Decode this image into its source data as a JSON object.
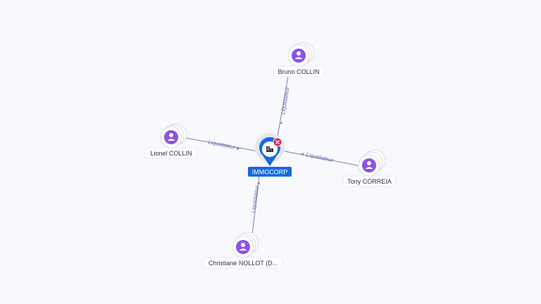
{
  "colors": {
    "background": "#f8f9fc",
    "person_node": "#8b52e8",
    "company_pin": "#1769e0",
    "status_badge": "#e5254a",
    "edge": "#7d80a6"
  },
  "center": {
    "label": "IMMOCORP",
    "icon": "building-icon",
    "badge_icon": "close-icon"
  },
  "nodes": [
    {
      "id": "bruno",
      "label": "Bruno COLLIN",
      "icon": "person-icon",
      "relation": "Liquidateur"
    },
    {
      "id": "lionel",
      "label": "Lionel COLLIN",
      "icon": "person-icon",
      "relation": "Liquidateur"
    },
    {
      "id": "tony",
      "label": "Tony CORREIA",
      "icon": "person-icon",
      "relation": "Liquidateur"
    },
    {
      "id": "christiane",
      "label": "Christiane NOLLOT (D...",
      "icon": "person-icon",
      "relation": "Liquidateur"
    }
  ]
}
